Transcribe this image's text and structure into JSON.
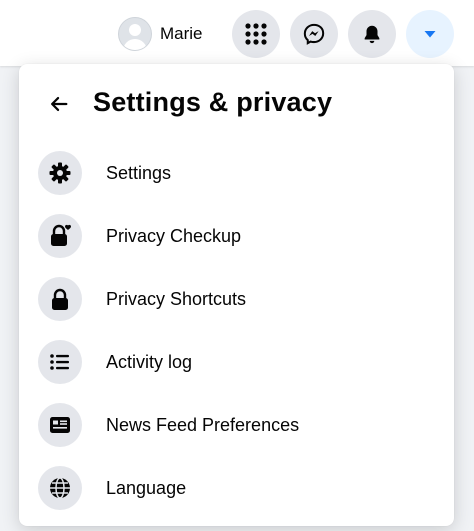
{
  "topbar": {
    "profile_name": "Marie",
    "buttons": [
      {
        "icon": "menu-grid-icon"
      },
      {
        "icon": "messenger-icon"
      },
      {
        "icon": "bell-icon"
      },
      {
        "icon": "caret-down-icon",
        "active": true
      }
    ]
  },
  "panel": {
    "title": "Settings & privacy",
    "items": [
      {
        "label": "Settings",
        "icon": "gear-icon"
      },
      {
        "label": "Privacy Checkup",
        "icon": "lock-heart-icon"
      },
      {
        "label": "Privacy Shortcuts",
        "icon": "lock-icon"
      },
      {
        "label": "Activity log",
        "icon": "list-icon"
      },
      {
        "label": "News Feed Preferences",
        "icon": "news-feed-icon"
      },
      {
        "label": "Language",
        "icon": "globe-icon"
      }
    ]
  },
  "colors": {
    "accent": "#1877f2",
    "icon_bg": "#e4e6eb",
    "active_bg": "#e7f3ff",
    "page_bg": "#f0f2f5"
  }
}
